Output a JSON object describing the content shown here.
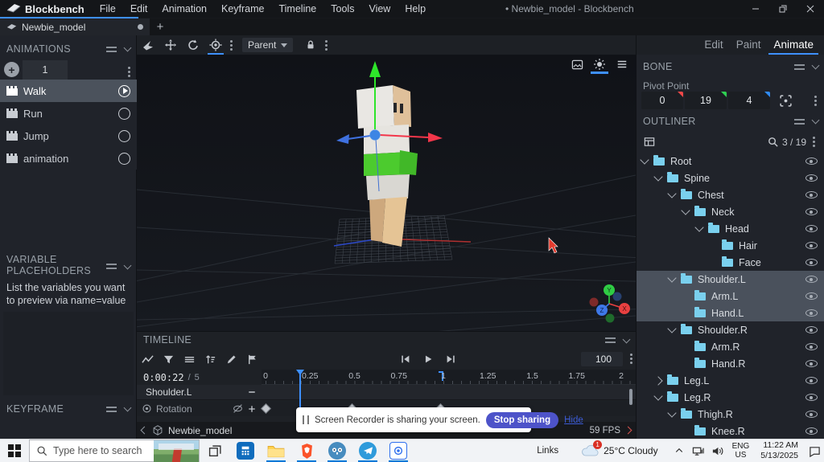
{
  "titlebar": {
    "app_name": "Blockbench",
    "menus": [
      "File",
      "Edit",
      "Animation",
      "Keyframe",
      "Timeline",
      "Tools",
      "View",
      "Help"
    ],
    "window_title": "• Newbie_model - Blockbench"
  },
  "tabbar": {
    "tab_label": "Newbie_model",
    "new_tab": "+"
  },
  "mode_tabs": {
    "items": [
      "Edit",
      "Paint",
      "Animate"
    ],
    "active": "Animate"
  },
  "toolbar": {
    "tools": [
      {
        "name": "transform-tool",
        "active": false
      },
      {
        "name": "move-tool",
        "active": false
      },
      {
        "name": "rotate-tool",
        "active": false
      },
      {
        "name": "pivot-tool",
        "active": true
      }
    ],
    "parent_label": "Parent"
  },
  "animations_panel": {
    "title": "ANIMATIONS",
    "file_tab": "1",
    "items": [
      {
        "label": "Walk",
        "selected": true
      },
      {
        "label": "Run",
        "selected": false
      },
      {
        "label": "Jump",
        "selected": false
      },
      {
        "label": "animation",
        "selected": false
      }
    ]
  },
  "variable_placeholders_panel": {
    "title": "VARIABLE PLACEHOLDERS",
    "description": "List the variables you want to preview via name=value"
  },
  "keyframe_panel": {
    "title": "KEYFRAME"
  },
  "bone_panel": {
    "title": "BONE",
    "pivot_point_label": "Pivot Point",
    "pivot": {
      "x": "0",
      "y": "19",
      "z": "4"
    }
  },
  "outliner": {
    "title": "OUTLINER",
    "count": "3 / 19",
    "nodes": [
      {
        "label": "Root",
        "level": 0,
        "arrow": "open",
        "selected": false
      },
      {
        "label": "Spine",
        "level": 1,
        "arrow": "open",
        "selected": false
      },
      {
        "label": "Chest",
        "level": 2,
        "arrow": "open",
        "selected": false
      },
      {
        "label": "Neck",
        "level": 3,
        "arrow": "open",
        "selected": false
      },
      {
        "label": "Head",
        "level": 4,
        "arrow": "open",
        "selected": false
      },
      {
        "label": "Hair",
        "level": 5,
        "arrow": "none",
        "selected": false
      },
      {
        "label": "Face",
        "level": 5,
        "arrow": "none",
        "selected": false
      },
      {
        "label": "Shoulder.L",
        "level": 2,
        "arrow": "open",
        "selected": true
      },
      {
        "label": "Arm.L",
        "level": 3,
        "arrow": "none",
        "selected": true
      },
      {
        "label": "Hand.L",
        "level": 3,
        "arrow": "none",
        "selected": true
      },
      {
        "label": "Shoulder.R",
        "level": 2,
        "arrow": "open",
        "selected": false
      },
      {
        "label": "Arm.R",
        "level": 3,
        "arrow": "none",
        "selected": false
      },
      {
        "label": "Hand.R",
        "level": 3,
        "arrow": "none",
        "selected": false
      },
      {
        "label": "Leg.L",
        "level": 1,
        "arrow": "collapsed",
        "selected": false
      },
      {
        "label": "Leg.R",
        "level": 1,
        "arrow": "open",
        "selected": false
      },
      {
        "label": "Thigh.R",
        "level": 2,
        "arrow": "open",
        "selected": false
      },
      {
        "label": "Knee.R",
        "level": 3,
        "arrow": "none",
        "selected": false
      }
    ]
  },
  "timeline": {
    "title": "TIMELINE",
    "tool_icons": [
      "graph",
      "filter",
      "lines",
      "sort",
      "pencil",
      "flag"
    ],
    "transport": [
      "skip-start",
      "play",
      "skip-end"
    ],
    "speed_value": "100",
    "time_current": "0:00:22",
    "time_divider": "/",
    "time_total": "5",
    "ruler_labels": [
      "0",
      "0.25",
      "0.5",
      "0.75",
      "1",
      "1.25",
      "1.5",
      "1.75",
      "2"
    ],
    "playhead_t": 0.19,
    "end_marker_t": 1.0,
    "track_name": "Shoulder.L",
    "channel_name": "Rotation",
    "keyframe_times": [
      0,
      0.485,
      0.985
    ]
  },
  "statusbar": {
    "model_name": "Newbie_model",
    "fps": "59 FPS"
  },
  "toast": {
    "message": "Screen Recorder is sharing your screen.",
    "stop_button": "Stop sharing",
    "hide_link": "Hide"
  },
  "taskbar": {
    "search_placeholder": "Type here to search",
    "links_label": "Links",
    "weather_badge": "1",
    "weather_temp": "25°C",
    "weather_condition": "Cloudy",
    "lang_line1": "ENG",
    "lang_line2": "US",
    "time": "11:22 AM",
    "date": "5/13/2025",
    "apps": [
      {
        "name": "calculator",
        "open": false
      },
      {
        "name": "file-explorer",
        "open": true
      },
      {
        "name": "brave",
        "open": true
      },
      {
        "name": "godot",
        "open": true
      },
      {
        "name": "telegram",
        "open": true
      },
      {
        "name": "screen-recorder",
        "open": true
      }
    ]
  },
  "colors": {
    "accent": "#3e90ff",
    "selection": "#4a515c",
    "folder_icon": "#7ad0ee",
    "toast_button": "#4d53c9",
    "taskbar_underline": "#0078d7",
    "gizmo_x": "#f3364a",
    "gizmo_y": "#2ee52a",
    "gizmo_z": "#3f71e0"
  }
}
